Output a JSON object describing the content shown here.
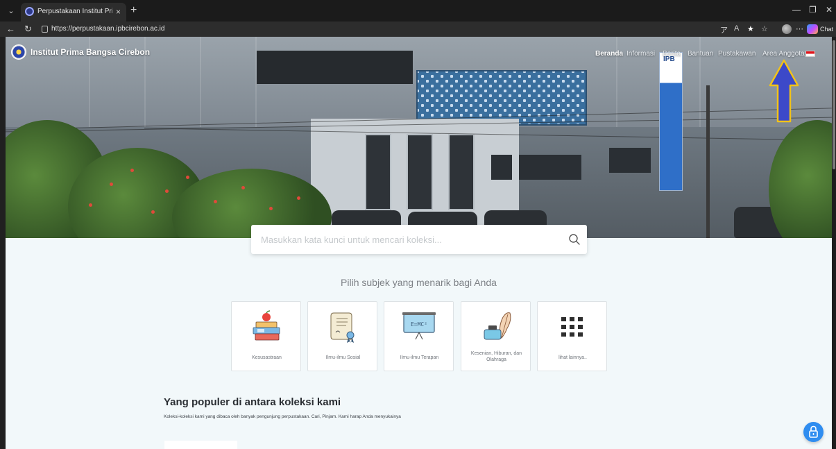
{
  "browser": {
    "tab_title": "Perpustakaan Institut Prima Bangs",
    "tab_close": "×",
    "new_tab": "+",
    "url": "https://perpustakaan.ipbcirebon.ac.id",
    "chat_label": "Chat",
    "icons": [
      "tab-list-icon",
      "back-icon",
      "reload-icon",
      "lock-icon",
      "translate-icon",
      "read-aloud-icon",
      "favorite-icon",
      "favorites-icon",
      "profile-icon",
      "more-icon",
      "copilot-icon",
      "minimize-icon",
      "restore-icon",
      "close-icon"
    ]
  },
  "site": {
    "brand_name": "Institut Prima Bangsa Cirebon",
    "sign_text": "IPB",
    "nav": [
      "Beranda",
      "Informasi",
      "Berita",
      "Bantuan",
      "Pustakawan",
      "Area Anggota"
    ],
    "active_nav": "Beranda",
    "annotation_color": "#f2c318",
    "annotation_fill": "#3c49c9"
  },
  "search": {
    "placeholder": "Masukkan kata kunci untuk mencari koleksi..."
  },
  "subjects": {
    "heading": "Pilih subjek yang menarik bagi Anda",
    "items": [
      {
        "label": "Kesusastraan",
        "icon": "books-apple-icon"
      },
      {
        "label": "Ilmu-ilmu Sosial",
        "icon": "certificate-icon"
      },
      {
        "label": "Ilmu-ilmu Terapan",
        "icon": "whiteboard-formula-icon"
      },
      {
        "label": "Kesenian, Hiburan, dan Olahraga",
        "icon": "ink-quill-icon"
      },
      {
        "label": "lihat lainnya..",
        "icon": "grid-icon"
      }
    ],
    "board_formula": "E=MC²"
  },
  "popular": {
    "title": "Yang populer di antara koleksi kami",
    "subtitle": "Koleksi-koleksi kami yang dibaca oleh banyak pengunjung perpustakaan. Cari, Pinjam. Kami harap Anda menyukainya"
  },
  "colors": {
    "page_bg": "#f2f8fa",
    "fab": "#2f8df0",
    "chrome_bg": "#1b1b1b"
  }
}
